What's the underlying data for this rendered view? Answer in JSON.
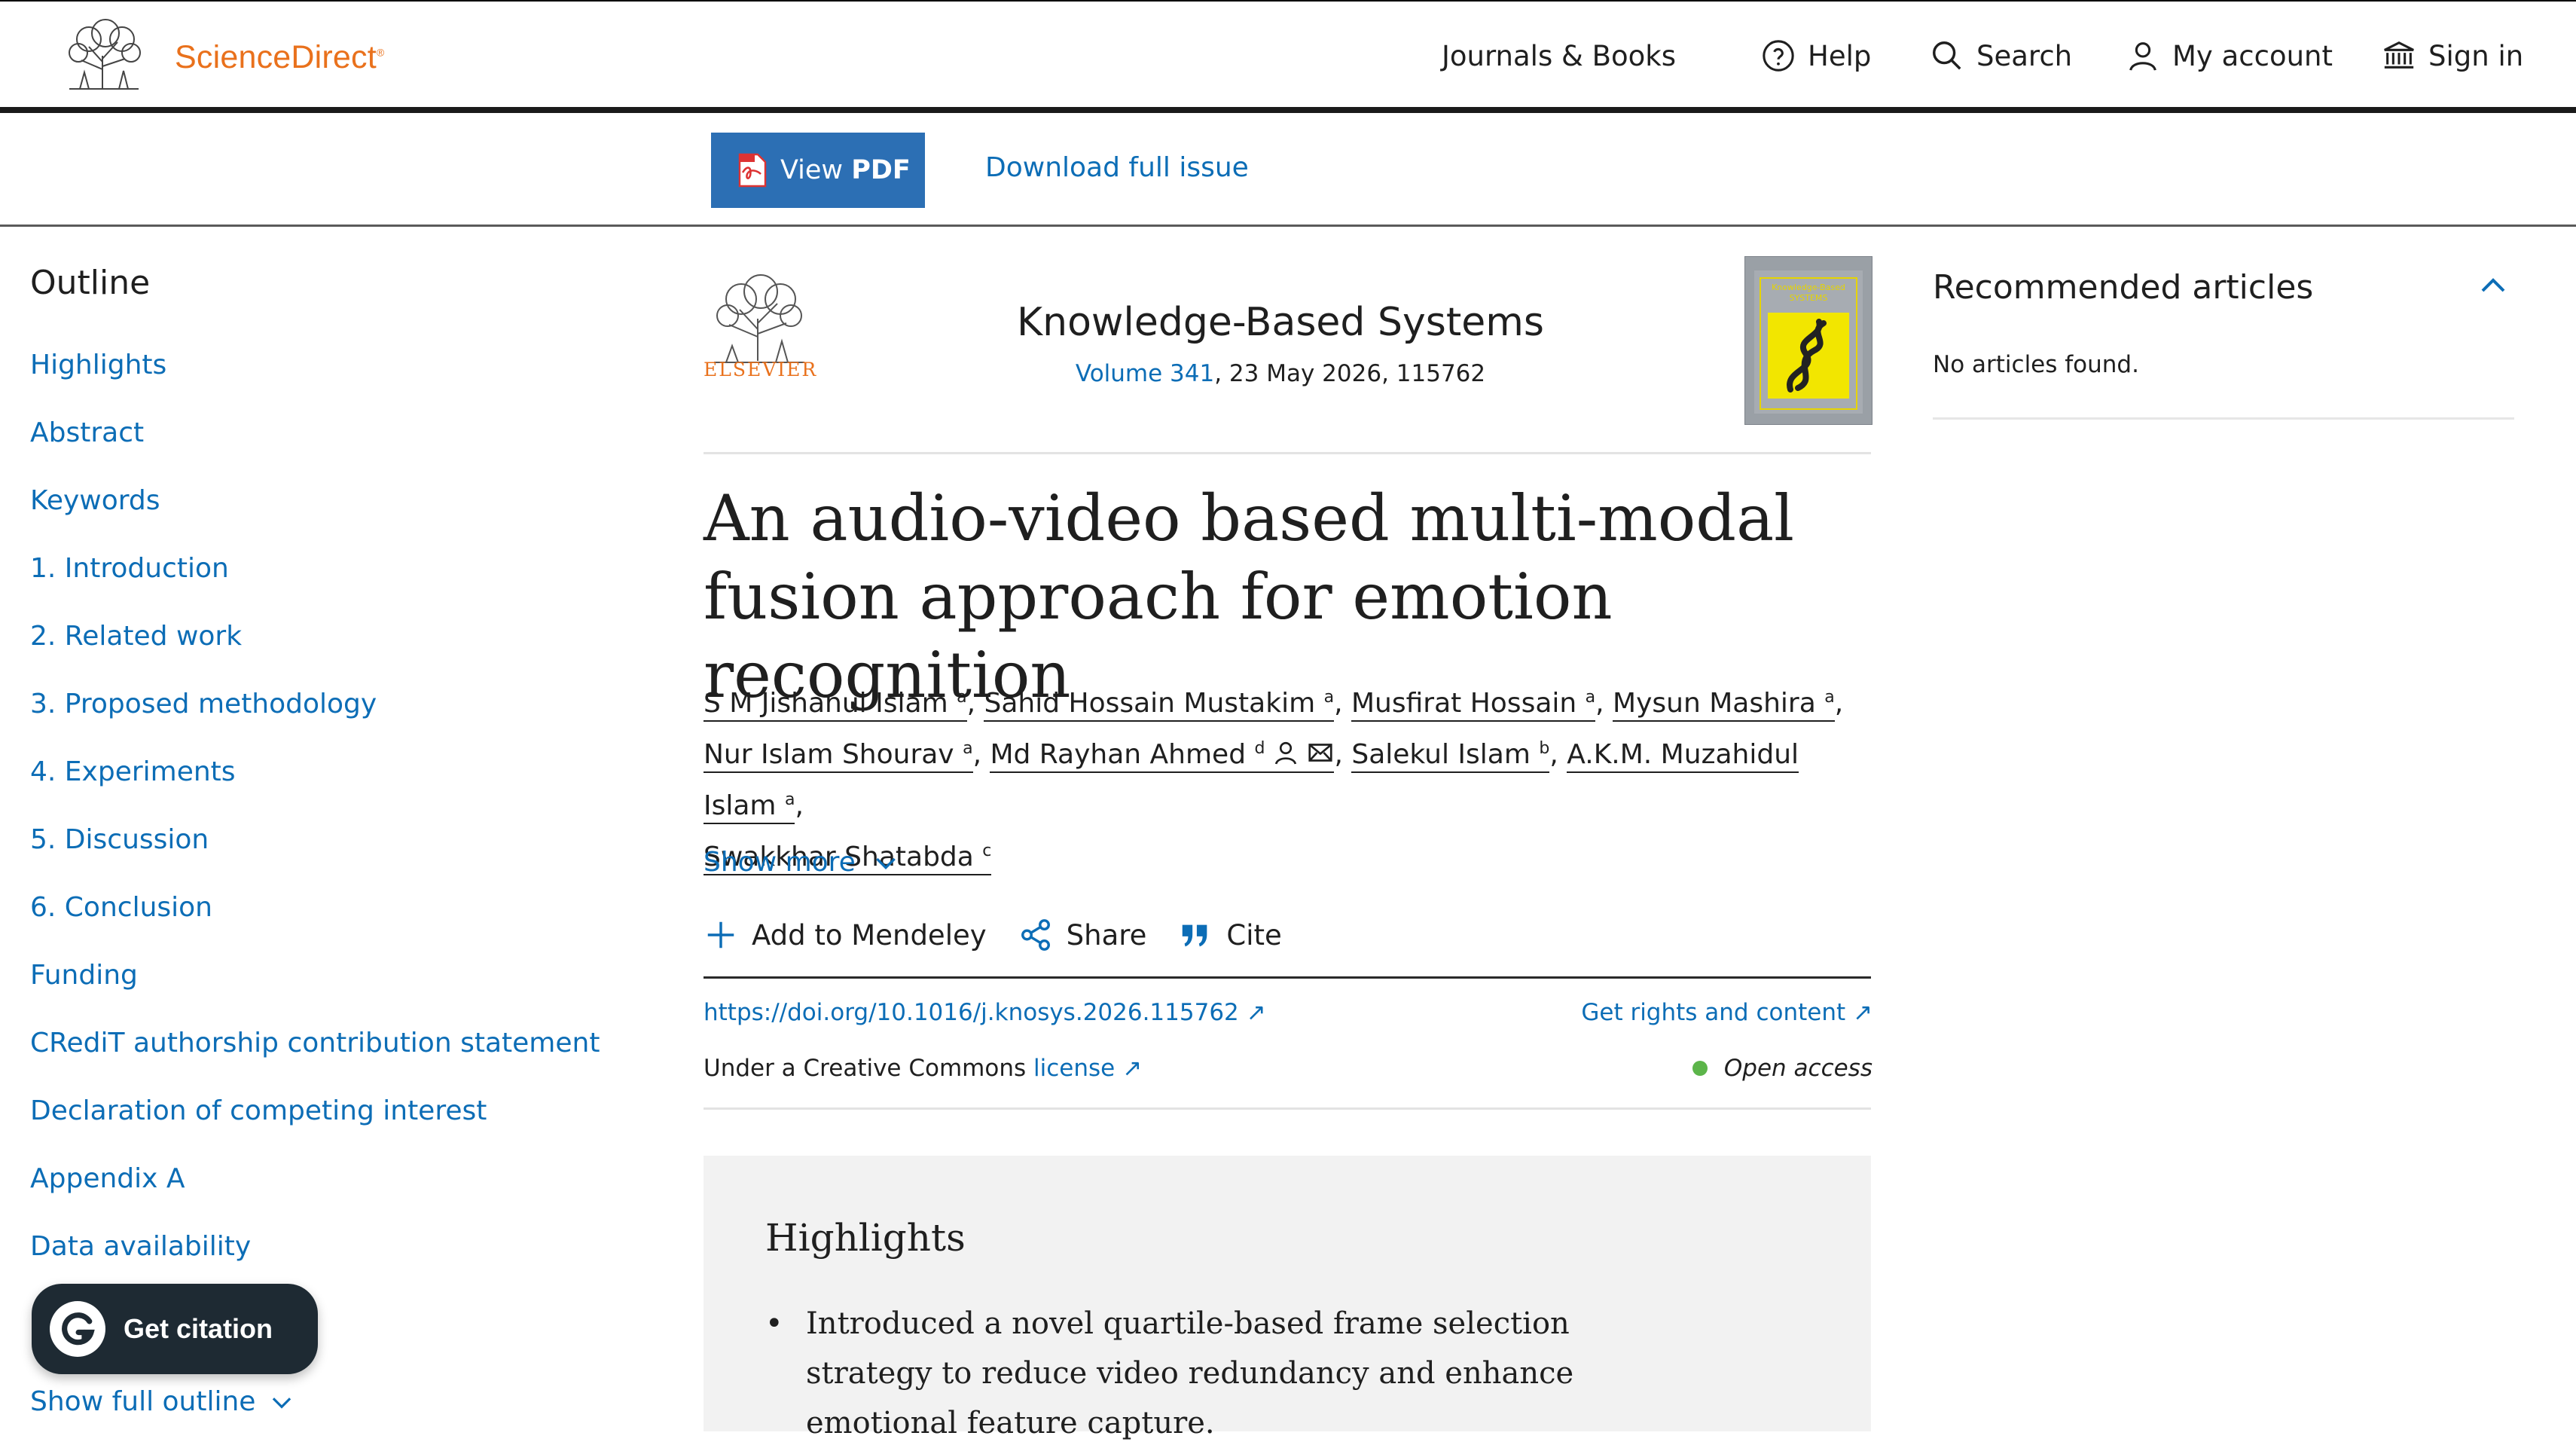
{
  "header": {
    "brand": "ScienceDirect",
    "brand_mark": "®",
    "nav": [
      {
        "label": "Journals & Books",
        "icon": ""
      },
      {
        "label": "Help",
        "icon": "help-circle-icon"
      },
      {
        "label": "Search",
        "icon": "search-icon"
      },
      {
        "label": "My account",
        "icon": "user-icon"
      },
      {
        "label": "Sign in",
        "icon": "institution-icon"
      }
    ]
  },
  "toolbar": {
    "view_pdf_prefix": "View",
    "view_pdf_bold": "PDF",
    "download_issue": "Download full issue"
  },
  "outline": {
    "title": "Outline",
    "items": [
      "Highlights",
      "Abstract",
      "Keywords",
      "1. Introduction",
      "2. Related work",
      "3. Proposed methodology",
      "4. Experiments",
      "5. Discussion",
      "6. Conclusion",
      "Funding",
      "CRediT authorship contribution statement",
      "Declaration of competing interest",
      "Appendix A",
      "Data availability"
    ],
    "show_full": "Show full outline",
    "get_citation": "Get citation"
  },
  "article": {
    "publisher_word": "ELSEVIER",
    "journal": "Knowledge-Based Systems",
    "volume_link": "Volume 341",
    "meta_rest": ", 23 May 2026, 115762",
    "title": "An audio-video based multi-modal fusion approach for emotion recognition",
    "authors": [
      {
        "name": "S M Jishanul Islam",
        "aff": "a"
      },
      {
        "name": "Sahid Hossain Mustakim",
        "aff": "a"
      },
      {
        "name": "Musfirat Hossain",
        "aff": "a"
      },
      {
        "name": "Mysun Mashira",
        "aff": "a"
      },
      {
        "name": "Nur Islam Shourav",
        "aff": "a"
      },
      {
        "name": "Md Rayhan Ahmed",
        "aff": "d"
      },
      {
        "name": "Salekul Islam",
        "aff": "b"
      },
      {
        "name": "A.K.M. Muzahidul Islam",
        "aff": "a"
      },
      {
        "name": "Swakkhar Shatabda",
        "aff": "c"
      }
    ],
    "show_more": "Show more",
    "actions": [
      "Add to Mendeley",
      "Share",
      "Cite"
    ],
    "doi": "https://doi.org/10.1016/j.knosys.2026.115762",
    "rights": "Get rights and content",
    "license_prefix": "Under a Creative Commons",
    "license_link": "license",
    "open_access": "Open access",
    "cover_title": "Knowledge-Based SYSTEMS",
    "highlights_title": "Highlights",
    "highlights": [
      "Introduced a novel quartile-based frame selection strategy to reduce video redundancy and enhance emotional feature capture."
    ]
  },
  "recommended": {
    "title": "Recommended articles",
    "empty": "No articles found."
  },
  "colors": {
    "brand_orange": "#e9711c",
    "link_blue": "#0c6db6",
    "pdf_button": "#2c6fb4",
    "open_access_dot": "#5cb54a"
  }
}
